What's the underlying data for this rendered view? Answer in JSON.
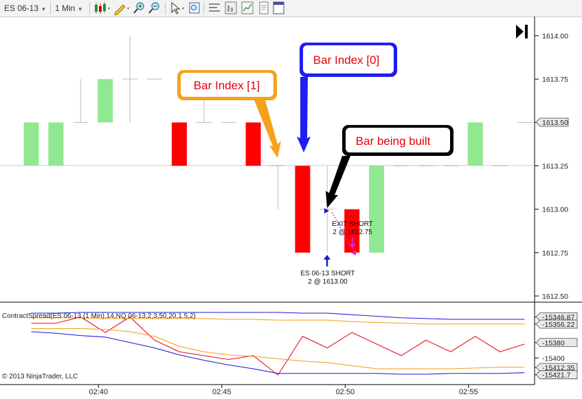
{
  "toolbar": {
    "instrument": "ES 06-13",
    "interval": "1 Min"
  },
  "chart_data": [
    {
      "type": "candlestick",
      "instrument": "ES 06-13",
      "interval": "1 Min",
      "y_ticks": [
        "1614.00",
        "1613.75",
        "1613.50",
        "1613.25",
        "1613.00",
        "1612.75",
        "1612.50"
      ],
      "ylim": [
        1612.44,
        1614.12
      ],
      "x_ticks": [
        "02:40",
        "02:45",
        "02:50",
        "02:55"
      ],
      "last_price": "1613.50",
      "bars": [
        {
          "time": "02:38",
          "open": 1613.25,
          "high": 1613.5,
          "low": 1613.25,
          "close": 1613.5
        },
        {
          "time": "02:39",
          "open": 1613.25,
          "high": 1613.5,
          "low": 1613.25,
          "close": 1613.5
        },
        {
          "time": "02:40",
          "open": 1613.5,
          "high": 1613.75,
          "low": 1613.5,
          "close": 1613.5
        },
        {
          "time": "02:41",
          "open": 1613.5,
          "high": 1613.75,
          "low": 1613.5,
          "close": 1613.75
        },
        {
          "time": "02:42",
          "open": 1613.75,
          "high": 1614.0,
          "low": 1613.5,
          "close": 1613.75
        },
        {
          "time": "02:43",
          "open": 1613.75,
          "high": 1613.75,
          "low": 1613.75,
          "close": 1613.75
        },
        {
          "time": "02:44",
          "open": 1613.5,
          "high": 1613.5,
          "low": 1613.25,
          "close": 1613.25
        },
        {
          "time": "02:45",
          "open": 1613.5,
          "high": 1613.75,
          "low": 1613.5,
          "close": 1613.5
        },
        {
          "time": "02:46",
          "open": 1613.5,
          "high": 1613.5,
          "low": 1613.5,
          "close": 1613.5
        },
        {
          "time": "02:47",
          "open": 1613.5,
          "high": 1613.5,
          "low": 1613.25,
          "close": 1613.25
        },
        {
          "time": "02:48",
          "open": 1613.25,
          "high": 1613.25,
          "low": 1613.0,
          "close": 1613.25
        },
        {
          "time": "02:49",
          "open": 1613.25,
          "high": 1613.25,
          "low": 1612.75,
          "close": 1612.75
        },
        {
          "time": "02:50",
          "open": 1613.0,
          "high": 1613.25,
          "low": 1612.75,
          "close": 1613.0
        },
        {
          "time": "02:51",
          "open": 1613.0,
          "high": 1613.0,
          "low": 1612.75,
          "close": 1612.75
        },
        {
          "time": "02:52",
          "open": 1612.75,
          "high": 1613.25,
          "low": 1612.75,
          "close": 1613.25
        },
        {
          "time": "02:53",
          "open": 1613.25,
          "high": 1613.25,
          "low": 1613.25,
          "close": 1613.25
        },
        {
          "time": "02:54",
          "open": 1613.25,
          "high": 1613.25,
          "low": 1613.25,
          "close": 1613.25
        },
        {
          "time": "02:55",
          "open": 1613.25,
          "high": 1613.25,
          "low": 1613.25,
          "close": 1613.25
        },
        {
          "time": "02:56",
          "open": 1613.25,
          "high": 1613.5,
          "low": 1613.25,
          "close": 1613.5
        },
        {
          "time": "02:57",
          "open": 1613.25,
          "high": 1613.25,
          "low": 1613.25,
          "close": 1613.25
        },
        {
          "time": "02:58",
          "open": 1613.5,
          "high": 1613.5,
          "low": 1613.5,
          "close": 1613.5
        }
      ],
      "annotations": [
        {
          "text": "Bar Index [1]",
          "color": "#f5a21b",
          "points_to": "02:48"
        },
        {
          "text": "Bar Index [0]",
          "color": "#1e1ef0",
          "points_to": "02:49"
        },
        {
          "text": "Bar being built",
          "color": "#000000",
          "points_to": "02:50"
        }
      ],
      "trades": {
        "entry": {
          "line1": "ES 06-13 SHORT",
          "line2": "2 @ 1613.00",
          "time": "02:50",
          "price": 1613.0
        },
        "exit": {
          "line1": "EXIT SHORT",
          "line2": "2 @ 1612.75",
          "time": "02:51",
          "price": 1612.75
        }
      }
    },
    {
      "type": "line",
      "title": "ContractSpread(ES 06-13 (1 Min),14,NQ 06-13,2,3,50,20,1.5,2)",
      "x": [
        "02:38",
        "02:39",
        "02:40",
        "02:41",
        "02:42",
        "02:43",
        "02:44",
        "02:45",
        "02:46",
        "02:47",
        "02:48",
        "02:49",
        "02:50",
        "02:51",
        "02:52",
        "02:53",
        "02:54",
        "02:55",
        "02:56",
        "02:57",
        "02:58"
      ],
      "ylim": [
        -15422,
        -15342
      ],
      "y_tags": [
        "-15346.87",
        "-15356.22",
        "-15380",
        "-15400",
        "-15412.35",
        "-15421.7"
      ],
      "series": [
        {
          "color": "#e8101a",
          "values": [
            -15355,
            -15355,
            -15347,
            -15367,
            -15347,
            -15377,
            -15392,
            -15397,
            -15402,
            -15397,
            -15422,
            -15372,
            -15387,
            -15367,
            -15382,
            -15397,
            -15377,
            -15392,
            -15372,
            -15392,
            -15382
          ]
        },
        {
          "color": "#1a1ad8",
          "values": [
            -15366,
            -15368,
            -15371,
            -15373,
            -15380,
            -15387,
            -15396,
            -15403,
            -15409,
            -15414,
            -15420,
            -15420,
            -15420,
            -15420,
            -15420,
            -15421,
            -15421,
            -15420,
            -15420,
            -15420,
            -15419
          ]
        },
        {
          "color": "#f59d16",
          "values": [
            -15362,
            -15362,
            -15362,
            -15363,
            -15366,
            -15372,
            -15385,
            -15392,
            -15396,
            -15398,
            -15401,
            -15404,
            -15406,
            -15410,
            -15414,
            -15414,
            -15414,
            -15414,
            -15413,
            -15412,
            -15412
          ]
        },
        {
          "color": "#1a1ad8",
          "values": [
            -15342,
            -15342,
            -15341,
            -15341,
            -15341,
            -15341,
            -15341,
            -15341,
            -15341,
            -15341,
            -15341,
            -15342,
            -15342,
            -15344,
            -15346,
            -15348,
            -15349,
            -15350,
            -15350,
            -15350,
            -15350
          ]
        },
        {
          "color": "#f59d16",
          "values": [
            -15348,
            -15348,
            -15348,
            -15349,
            -15349,
            -15349,
            -15349,
            -15349,
            -15350,
            -15350,
            -15351,
            -15351,
            -15351,
            -15353,
            -15354,
            -15355,
            -15356,
            -15356,
            -15356,
            -15356,
            -15356
          ]
        }
      ]
    }
  ],
  "copyright": "© 2013 NinjaTrader, LLC"
}
